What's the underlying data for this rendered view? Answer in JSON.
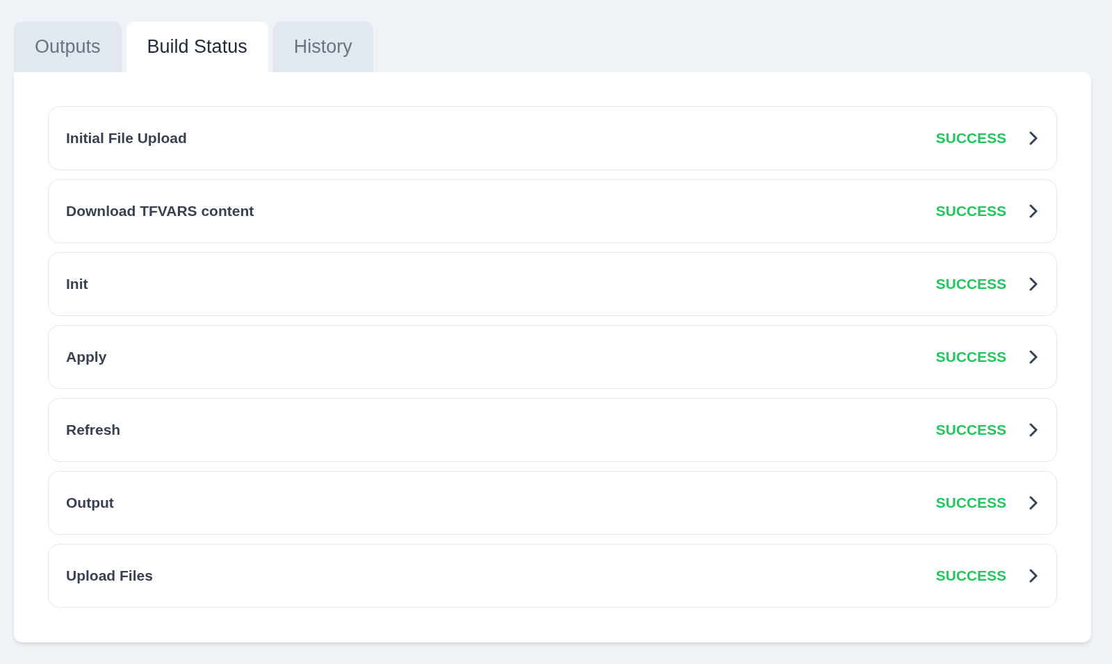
{
  "tabs": [
    {
      "label": "Outputs",
      "selected": false
    },
    {
      "label": "Build Status",
      "selected": true
    },
    {
      "label": "History",
      "selected": false
    }
  ],
  "steps": [
    {
      "name": "Initial File Upload",
      "status": "SUCCESS"
    },
    {
      "name": "Download TFVARS content",
      "status": "SUCCESS"
    },
    {
      "name": "Init",
      "status": "SUCCESS"
    },
    {
      "name": "Apply",
      "status": "SUCCESS"
    },
    {
      "name": "Refresh",
      "status": "SUCCESS"
    },
    {
      "name": "Output",
      "status": "SUCCESS"
    },
    {
      "name": "Upload Files",
      "status": "SUCCESS"
    }
  ]
}
